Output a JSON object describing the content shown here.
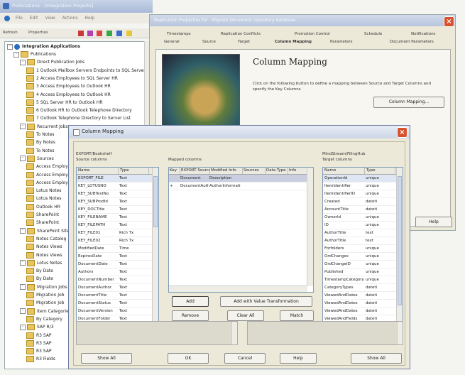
{
  "main_window": {
    "title": "Publications - [Integration Projects]",
    "menu": [
      "File",
      "Edit",
      "View",
      "Actions",
      "Help"
    ],
    "toolbar_items": [
      "Refresh",
      "Properties"
    ]
  },
  "tree": {
    "root": "Integration Applications",
    "items": [
      {
        "label": "Publications",
        "level": 1,
        "expand": "-"
      },
      {
        "label": "Direct Publication Jobs",
        "level": 2,
        "expand": "-"
      },
      {
        "label": "1 Outlook Mailbox Servers Endpoints to SQL Server",
        "level": 3
      },
      {
        "label": "2 Access Employees to SQL Server HR",
        "level": 3
      },
      {
        "label": "3 Access Employees to Outlook HR",
        "level": 3
      },
      {
        "label": "4 Access Employees to Outlook HR",
        "level": 3
      },
      {
        "label": "5 SQL Server HR to Outlook HR",
        "level": 3
      },
      {
        "label": "6 Outlook HR to Outlook Telephone Directory",
        "level": 3
      },
      {
        "label": "7 Outlook Telephone Directory to Server List",
        "level": 3
      },
      {
        "label": "Recurrent Jobs",
        "level": 2,
        "expand": "-"
      },
      {
        "label": "To Notes",
        "level": 3
      },
      {
        "label": "By Notes",
        "level": 3
      },
      {
        "label": "To Notes",
        "level": 3
      },
      {
        "label": "Sources",
        "level": 2,
        "expand": "-"
      },
      {
        "label": "Access Employees",
        "level": 3
      },
      {
        "label": "Access Employees",
        "level": 3
      },
      {
        "label": "Access Employees",
        "level": 3
      },
      {
        "label": "Lotus Notes",
        "level": 3
      },
      {
        "label": "Lotus Notes",
        "level": 3
      },
      {
        "label": "Outlook HR",
        "level": 3
      },
      {
        "label": "SharePoint",
        "level": 3
      },
      {
        "label": "SharePoint",
        "level": 3
      },
      {
        "label": "SharePoint Sites",
        "level": 2,
        "expand": "-"
      },
      {
        "label": "Notes Catalog",
        "level": 3
      },
      {
        "label": "Notes Views",
        "level": 3
      },
      {
        "label": "Notes Views",
        "level": 3
      },
      {
        "label": "Lotus Notes",
        "level": 2,
        "expand": "-"
      },
      {
        "label": "By Date",
        "level": 3
      },
      {
        "label": "By Date",
        "level": 3
      },
      {
        "label": "Migration Jobs",
        "level": 2,
        "expand": "-"
      },
      {
        "label": "Migration Job",
        "level": 3
      },
      {
        "label": "Migration Job",
        "level": 3
      },
      {
        "label": "Item Categories",
        "level": 2,
        "expand": "-"
      },
      {
        "label": "By Category",
        "level": 3
      },
      {
        "label": "SAP R/3",
        "level": 2,
        "expand": "-"
      },
      {
        "label": "R3 SAP",
        "level": 3
      },
      {
        "label": "R3 SAP",
        "level": 3
      },
      {
        "label": "R3 SAP",
        "level": 3
      },
      {
        "label": "R3 Fields",
        "level": 3
      }
    ]
  },
  "properties_window": {
    "title": "Replication Properties for - Migrate Document repository database",
    "tabs_row1": [
      "Timestamps",
      "Replication Conflicts",
      "Promotion Control",
      "Schedule",
      "Notifications"
    ],
    "tabs_row2": [
      "General",
      "Source",
      "Target",
      "Column Mapping",
      "Parameters",
      "Document Parameters"
    ],
    "heading": "Column Mapping",
    "description": "Click on the following button to define a mapping between Source and Target Columns and specify the Key Columns",
    "column_mapping_button": "Column Mapping...",
    "help_button": "Help"
  },
  "dialog": {
    "title": "Column Mapping",
    "source": {
      "name": "EXPORT/Bookshelf",
      "label": "Source columns",
      "headers": [
        "Name",
        "Type"
      ],
      "rows": [
        [
          "EXPORT_FILE",
          "Text"
        ],
        [
          "KEY_LOTUSNO",
          "Text"
        ],
        [
          "KEY_SUBTextNo",
          "Text"
        ],
        [
          "KEY_SUBProdId",
          "Text"
        ],
        [
          "KEY_DOCTitle",
          "Text"
        ],
        [
          "KEY_FILENAME",
          "Text"
        ],
        [
          "KEY_FILEPATH",
          "Text"
        ],
        [
          "KEY_FILE01",
          "Rich Tx"
        ],
        [
          "KEY_FILE02",
          "Rich Tx"
        ],
        [
          "ModifiedDate",
          "Time"
        ],
        [
          "ExpiresDate",
          "Text"
        ],
        [
          "DocumentDate",
          "Text"
        ],
        [
          "Authors",
          "Text"
        ],
        [
          "DocumentNumber",
          "Text"
        ],
        [
          "DocumentAuthor",
          "Text"
        ],
        [
          "DocumentTitle",
          "Text"
        ],
        [
          "DocumentStatus",
          "Text"
        ],
        [
          "DocumentVersion",
          "Text"
        ],
        [
          "DocumentFolder",
          "Text"
        ]
      ]
    },
    "mapped": {
      "label": "Mapped columns",
      "headers": [
        "Key",
        "EXPORT Source",
        "Modified Info",
        "Sources",
        "Data Type",
        "Info"
      ],
      "rows": [
        [
          "",
          "Document",
          "Description",
          "",
          "",
          ""
        ],
        [
          "+",
          "DocumentAuthor",
          "AuthorInformation",
          "",
          "",
          ""
        ]
      ],
      "add_button": "Add",
      "add_transform_button": "Add with Value Transformation",
      "remove_button": "Remove",
      "clear_button": "Clear All",
      "match_button": "Match"
    },
    "target": {
      "name": "MindStream/FilingHub",
      "label": "Target columns",
      "headers": [
        "Name",
        "Type"
      ],
      "rows": [
        [
          "OperationId",
          "unique"
        ],
        [
          "ItemIdentifier",
          "unique"
        ],
        [
          "ItemIdentifierID",
          "unique"
        ],
        [
          "Created",
          "dateti"
        ],
        [
          "AccountTitle",
          "dateti"
        ],
        [
          "OwnerId",
          "unique"
        ],
        [
          "ID",
          "unique"
        ],
        [
          "AuthorTitle",
          "text"
        ],
        [
          "AuthorTitle",
          "text"
        ],
        [
          "Forfolders",
          "unique"
        ],
        [
          "OrdChanges",
          "unique"
        ],
        [
          "OrdChangeID",
          "unique"
        ],
        [
          "Published",
          "unique"
        ],
        [
          "TimestampCategory",
          "unique"
        ],
        [
          "CategoryTypes",
          "dateti"
        ],
        [
          "ViewedAndDates",
          "dateti"
        ],
        [
          "ViewedAndDates",
          "dateti"
        ],
        [
          "ViewedAndDates",
          "dateti"
        ],
        [
          "ViewedAndFields",
          "dateti"
        ]
      ]
    },
    "show_all_left": "Show All",
    "ok_button": "OK",
    "cancel_button": "Cancel",
    "help_button": "Help",
    "show_all_right": "Show All"
  }
}
